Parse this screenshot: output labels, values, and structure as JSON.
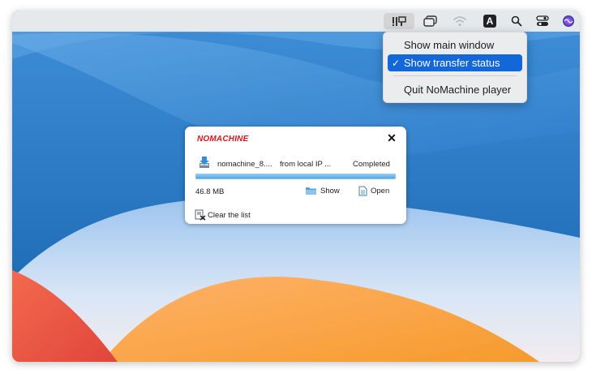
{
  "colors": {
    "accent": "#1467d8",
    "brand": "#d6161c",
    "progress": "#4aa7e8"
  },
  "menubar": {
    "icons": [
      "nomachine-icon",
      "window-icon",
      "wifi-icon",
      "keyboard-input-icon",
      "search-icon",
      "control-center-icon",
      "siri-icon"
    ],
    "input_letter": "A"
  },
  "menu": {
    "items": [
      {
        "label": "Show main window",
        "checked": false
      },
      {
        "label": "Show transfer status",
        "checked": true
      },
      {
        "label": "Quit NoMachine player",
        "checked": false
      }
    ],
    "check_glyph": "✓"
  },
  "transfer_panel": {
    "brand": "NOMACHINE",
    "close_glyph": "✕",
    "transfer": {
      "file": "nomachine_8....",
      "source": "from local IP ...",
      "status": "Completed",
      "progress": 1.0,
      "size": "46.8 MB"
    },
    "show_label": "Show",
    "open_label": "Open",
    "clear_label": "Clear the list"
  }
}
